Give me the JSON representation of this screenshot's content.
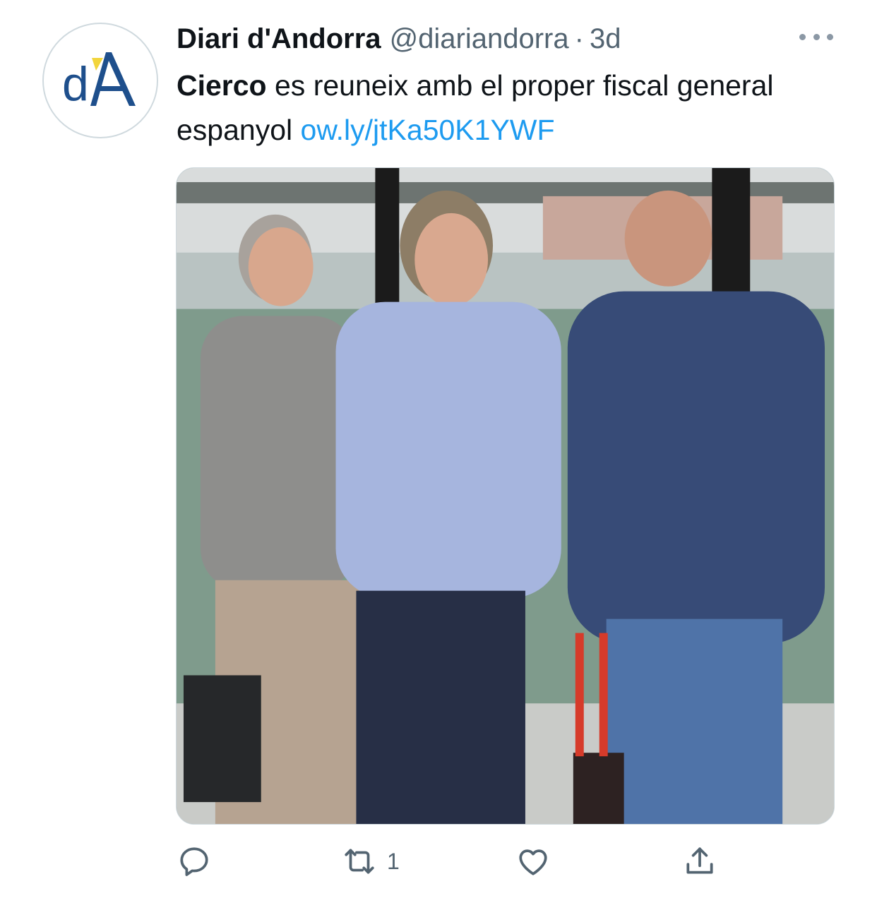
{
  "tweet": {
    "display_name": "Diari d'Andorra",
    "handle": "@diariandorra",
    "separator": "·",
    "time": "3d",
    "text_bold": "Cierco",
    "text_body": " es reuneix amb el proper fiscal general espanyol ",
    "link": "ow.ly/jtKa50K1YWF",
    "avatar_icon": "diari-dandorra-logo",
    "media_icon": "photo-image"
  },
  "actions": {
    "reply_icon": "reply-icon",
    "retweet_icon": "retweet-icon",
    "retweet_count": "1",
    "like_icon": "heart-icon",
    "share_icon": "share-icon"
  },
  "colors": {
    "link": "#1d9bf0",
    "secondary_text": "#536471",
    "logo_blue": "#1e4f8c",
    "logo_yellow": "#f2d53c"
  }
}
